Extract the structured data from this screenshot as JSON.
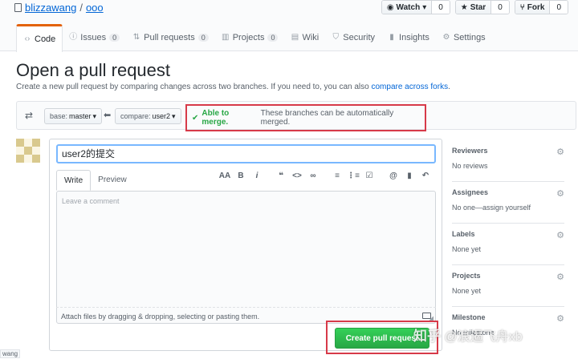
{
  "repo": {
    "owner": "blizzawang",
    "separator": "/",
    "name": "ooo"
  },
  "actions": [
    {
      "label": "Watch",
      "count": "0",
      "icon": "eye-icon"
    },
    {
      "label": "Star",
      "count": "0",
      "icon": "star-icon"
    },
    {
      "label": "Fork",
      "count": "0",
      "icon": "fork-icon"
    }
  ],
  "tabs": [
    {
      "label": "Code",
      "count": ""
    },
    {
      "label": "Issues",
      "count": "0"
    },
    {
      "label": "Pull requests",
      "count": "0"
    },
    {
      "label": "Projects",
      "count": "0"
    },
    {
      "label": "Wiki",
      "count": ""
    },
    {
      "label": "Security",
      "count": ""
    },
    {
      "label": "Insights",
      "count": ""
    },
    {
      "label": "Settings",
      "count": ""
    }
  ],
  "page": {
    "title": "Open a pull request",
    "description": "Create a new pull request by comparing changes across two branches. If you need to, you can also ",
    "description_link": "compare across forks",
    "description_end": "."
  },
  "compare": {
    "base_label": "base:",
    "base_value": "master",
    "compare_label": "compare:",
    "compare_value": "user2",
    "merge_status": "Able to merge.",
    "merge_message": "These branches can be automatically merged."
  },
  "form": {
    "title_value": "user2的提交",
    "tab_write": "Write",
    "tab_preview": "Preview",
    "comment_placeholder": "Leave a comment",
    "attach_text": "Attach files by dragging & dropping, selecting or pasting them.",
    "submit_label": "Create pull request"
  },
  "toolbar_icons": [
    "header-icon",
    "bold-icon",
    "italic-icon",
    "quote-icon",
    "code-icon",
    "link-icon",
    "unordered-list-icon",
    "ordered-list-icon",
    "task-list-icon",
    "mention-icon",
    "bookmark-icon",
    "reply-icon"
  ],
  "sidebar": [
    {
      "title": "Reviewers",
      "value": "No reviews"
    },
    {
      "title": "Assignees",
      "value": "No one—assign yourself"
    },
    {
      "title": "Labels",
      "value": "None yet"
    },
    {
      "title": "Projects",
      "value": "None yet"
    },
    {
      "title": "Milestone",
      "value": "No milestone"
    }
  ],
  "watermark": {
    "brand": "知乎",
    "handle": "@浪遏飞舟xb"
  },
  "left_tag": "wang",
  "colors": {
    "accent_red": "#d73a49",
    "link_blue": "#0366d6",
    "success_green": "#28a745",
    "tab_orange": "#e36209"
  }
}
